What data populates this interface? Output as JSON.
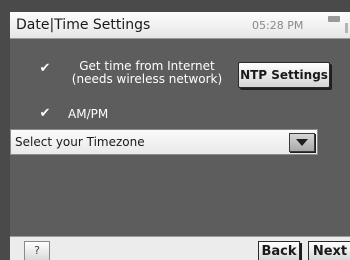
{
  "titlebar": {
    "title": "Date|Time Settings",
    "clock": "05:28 PM",
    "battery_icon": "battery-icon"
  },
  "internet_time": {
    "checked": true,
    "check_glyph": "✔",
    "label_line1": "Get time from Internet",
    "label_line2": "(needs wireless network)"
  },
  "ntp_button": {
    "label": "NTP Settings"
  },
  "ampm": {
    "checked": true,
    "check_glyph": "✔",
    "label": "AM/PM"
  },
  "timezone": {
    "value": "Select your Timezone",
    "dropdown_icon": "chevron-down-icon"
  },
  "bottombar": {
    "help_label": "?",
    "back_label": "Back",
    "next_label": "Next"
  },
  "colors": {
    "screen_bg": "#5d5d5d",
    "bezel": "#4a4a4a",
    "bar_bg": "#ececec",
    "text_light": "#ffffff",
    "text_dark": "#1a1a1a"
  }
}
